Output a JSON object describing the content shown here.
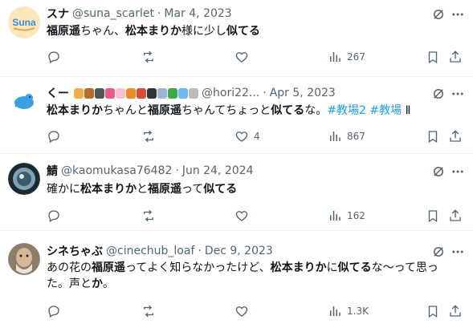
{
  "tweets": [
    {
      "display_name": "スナ",
      "handle": "@suna_scarlet",
      "separator": "·",
      "date": "Mar 4, 2023",
      "segments": [
        {
          "text": "福原遥",
          "bold": true
        },
        {
          "text": "ちゃん、",
          "bold": false
        },
        {
          "text": "松本まりか",
          "bold": true
        },
        {
          "text": "様に少し",
          "bold": false
        },
        {
          "text": "似てる",
          "bold": true
        }
      ],
      "reply_count": "",
      "retweet_count": "",
      "like_count": "",
      "view_count": "267"
    },
    {
      "display_name": "くー",
      "handle": "@hori22...",
      "separator": "·",
      "date": "Apr 5, 2023",
      "segments": [
        {
          "text": "松本まりか",
          "bold": true
        },
        {
          "text": "ちゃんと",
          "bold": false
        },
        {
          "text": "福原遥",
          "bold": true
        },
        {
          "text": "ちゃんてちょっと",
          "bold": false
        },
        {
          "text": "似てる",
          "bold": true
        },
        {
          "text": "な。",
          "bold": false
        },
        {
          "text": "#教場2",
          "hashtag": true
        },
        {
          "text": " ",
          "bold": false
        },
        {
          "text": "#教場",
          "hashtag": true
        },
        {
          "text": " Ⅱ",
          "bold": false
        }
      ],
      "reply_count": "",
      "retweet_count": "",
      "like_count": "4",
      "view_count": "867"
    },
    {
      "display_name": "鯖",
      "handle": "@kaomukasa76482",
      "separator": "·",
      "date": "Jun 24, 2024",
      "segments": [
        {
          "text": "確かに",
          "bold": false
        },
        {
          "text": "松本まりか",
          "bold": true
        },
        {
          "text": "と",
          "bold": false
        },
        {
          "text": "福原遥",
          "bold": true
        },
        {
          "text": "って",
          "bold": false
        },
        {
          "text": "似てる",
          "bold": true
        }
      ],
      "reply_count": "",
      "retweet_count": "",
      "like_count": "",
      "view_count": "162"
    },
    {
      "display_name": "シネちゃぶ",
      "handle": "@cinechub_loaf",
      "separator": "·",
      "date": "Dec 9, 2023",
      "segments": [
        {
          "text": "あの花の",
          "bold": false
        },
        {
          "text": "福原遥",
          "bold": true
        },
        {
          "text": "ってよく知らなかったけど、",
          "bold": false
        },
        {
          "text": "松本まりか",
          "bold": true
        },
        {
          "text": "に",
          "bold": false
        },
        {
          "text": "似てる",
          "bold": true
        },
        {
          "text": "な〜って思った。声と",
          "bold": false
        },
        {
          "text": "か",
          "bold": true
        },
        {
          "text": "。",
          "bold": false
        }
      ],
      "reply_count": "",
      "retweet_count": "",
      "like_count": "",
      "view_count": "1.3K"
    }
  ],
  "icons": {
    "reply": "reply-icon",
    "retweet": "retweet-icon",
    "like": "heart-icon",
    "views": "views-icon",
    "bookmark": "bookmark-icon",
    "share": "share-icon",
    "grok": "grok-icon",
    "more": "more-icon"
  },
  "colors": {
    "text": "#0f1419",
    "secondary": "#536471",
    "hashtag": "#1d9bf0",
    "divider": "#eff3f4"
  }
}
